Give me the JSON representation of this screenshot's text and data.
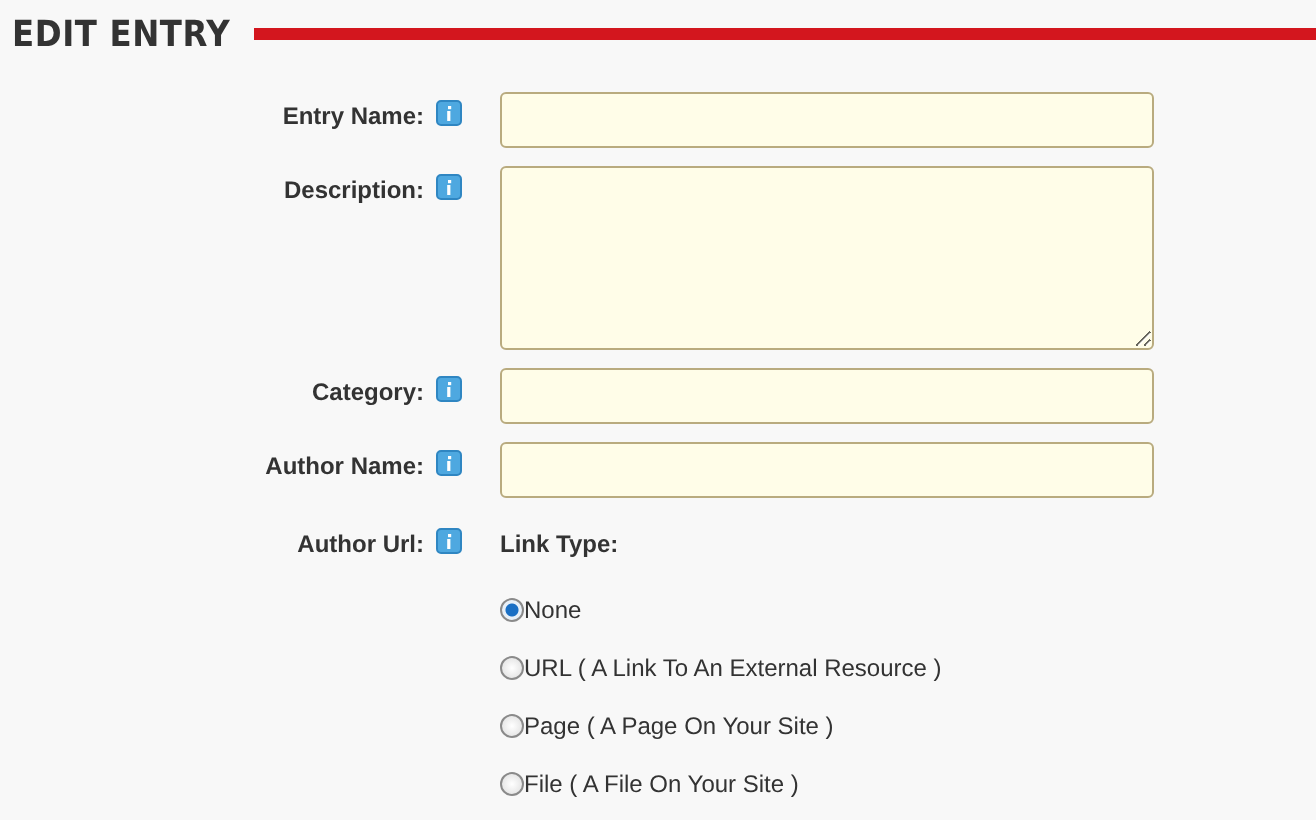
{
  "title": "EDIT ENTRY",
  "fields": [
    {
      "kind": "text",
      "label": "Entry Name:"
    },
    {
      "kind": "textarea",
      "label": "Description:"
    },
    {
      "kind": "text",
      "label": "Category:"
    },
    {
      "kind": "text",
      "label": "Author Name:"
    },
    {
      "kind": "link",
      "label": "Author Url:",
      "heading": "Link Type:",
      "options": [
        {
          "label": "None",
          "selected": true
        },
        {
          "label": "URL ( A Link To An External Resource )",
          "selected": false
        },
        {
          "label": "Page ( A Page On Your Site )",
          "selected": false
        },
        {
          "label": "File ( A File On Your Site )",
          "selected": false
        }
      ]
    }
  ]
}
